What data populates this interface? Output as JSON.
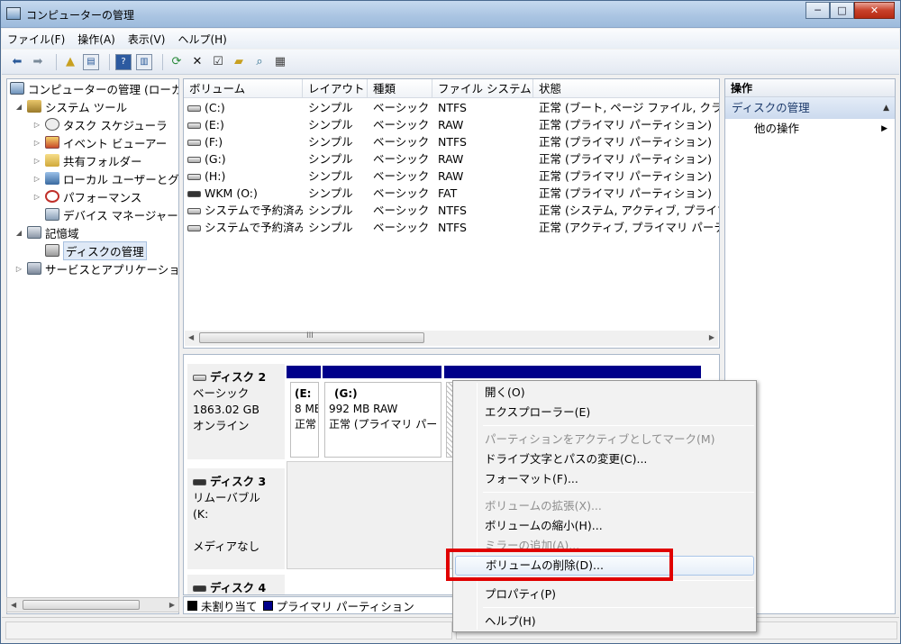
{
  "window": {
    "title": "コンピューターの管理"
  },
  "menubar": [
    "ファイル(F)",
    "操作(A)",
    "表示(V)",
    "ヘルプ(H)"
  ],
  "tree": {
    "root": "コンピューターの管理 (ローカ",
    "items": [
      {
        "label": "システム ツール",
        "level": 1,
        "exp": "◢"
      },
      {
        "label": "タスク スケジューラ",
        "level": 2,
        "exp": "▷"
      },
      {
        "label": "イベント ビューアー",
        "level": 2,
        "exp": "▷"
      },
      {
        "label": "共有フォルダー",
        "level": 2,
        "exp": "▷"
      },
      {
        "label": "ローカル ユーザーとグ",
        "level": 2,
        "exp": "▷"
      },
      {
        "label": "パフォーマンス",
        "level": 2,
        "exp": "▷"
      },
      {
        "label": "デバイス マネージャー",
        "level": 2,
        "exp": ""
      },
      {
        "label": "記憶域",
        "level": 1,
        "exp": "◢"
      },
      {
        "label": "ディスクの管理",
        "level": 2,
        "exp": "",
        "selected": true
      },
      {
        "label": "サービスとアプリケーショ",
        "level": 1,
        "exp": "▷"
      }
    ]
  },
  "volumes": {
    "columns": [
      "ボリューム",
      "レイアウト",
      "種類",
      "ファイル システム",
      "状態"
    ],
    "rows": [
      [
        "(C:)",
        "シンプル",
        "ベーシック",
        "NTFS",
        "正常 (ブート, ページ ファイル, クラッ"
      ],
      [
        "(E:)",
        "シンプル",
        "ベーシック",
        "RAW",
        "正常 (プライマリ パーティション)"
      ],
      [
        "(F:)",
        "シンプル",
        "ベーシック",
        "NTFS",
        "正常 (プライマリ パーティション)"
      ],
      [
        "(G:)",
        "シンプル",
        "ベーシック",
        "RAW",
        "正常 (プライマリ パーティション)"
      ],
      [
        "(H:)",
        "シンプル",
        "ベーシック",
        "RAW",
        "正常 (プライマリ パーティション)"
      ],
      [
        "WKM (O:)",
        "シンプル",
        "ベーシック",
        "FAT",
        "正常 (プライマリ パーティション)"
      ],
      [
        "システムで予約済み",
        "シンプル",
        "ベーシック",
        "NTFS",
        "正常 (システム, アクティブ, プライマ"
      ],
      [
        "システムで予約済み",
        "シンプル",
        "ベーシック",
        "NTFS",
        "正常 (アクティブ, プライマリ パーテ"
      ]
    ],
    "scroll_label": "III"
  },
  "disks": {
    "disk2": {
      "name": "ディスク 2",
      "type": "ベーシック",
      "size": "1863.02 GB",
      "status": "オンライン"
    },
    "disk3": {
      "name": "ディスク 3",
      "type": "リムーバブル (K:",
      "status": "メディアなし"
    },
    "disk4": {
      "name": "ディスク 4"
    },
    "part_e": {
      "name": "(E:",
      "size": "8 MB",
      "status": "正常"
    },
    "part_g": {
      "name": "(G:)",
      "size": "992 MB RAW",
      "status": "正常 (プライマリ パー"
    }
  },
  "legend": {
    "unallocated": "未割り当て",
    "primary": "プライマリ パーティション"
  },
  "actions": {
    "header": "操作",
    "section": "ディスクの管理",
    "item": "他の操作"
  },
  "context_menu": [
    {
      "label": "開く(O)",
      "disabled": false
    },
    {
      "label": "エクスプローラー(E)",
      "disabled": false
    },
    {
      "sep": true
    },
    {
      "label": "パーティションをアクティブとしてマーク(M)",
      "disabled": true
    },
    {
      "label": "ドライブ文字とパスの変更(C)...",
      "disabled": false
    },
    {
      "label": "フォーマット(F)...",
      "disabled": false
    },
    {
      "sep": true
    },
    {
      "label": "ボリュームの拡張(X)...",
      "disabled": true
    },
    {
      "label": "ボリュームの縮小(H)...",
      "disabled": false
    },
    {
      "label": "ミラーの追加(A)...",
      "disabled": true
    },
    {
      "label": "ボリュームの削除(D)...",
      "disabled": false,
      "highlighted": true
    },
    {
      "sep": true
    },
    {
      "label": "プロパティ(P)",
      "disabled": false
    },
    {
      "sep": true
    },
    {
      "label": "ヘルプ(H)",
      "disabled": false
    }
  ],
  "colors": {
    "primary_partition": "#00008a",
    "highlight_box": "#e00000",
    "unallocated": "#000000"
  },
  "icons": {
    "window_min": "─",
    "window_max": "□",
    "window_close": "✕"
  }
}
